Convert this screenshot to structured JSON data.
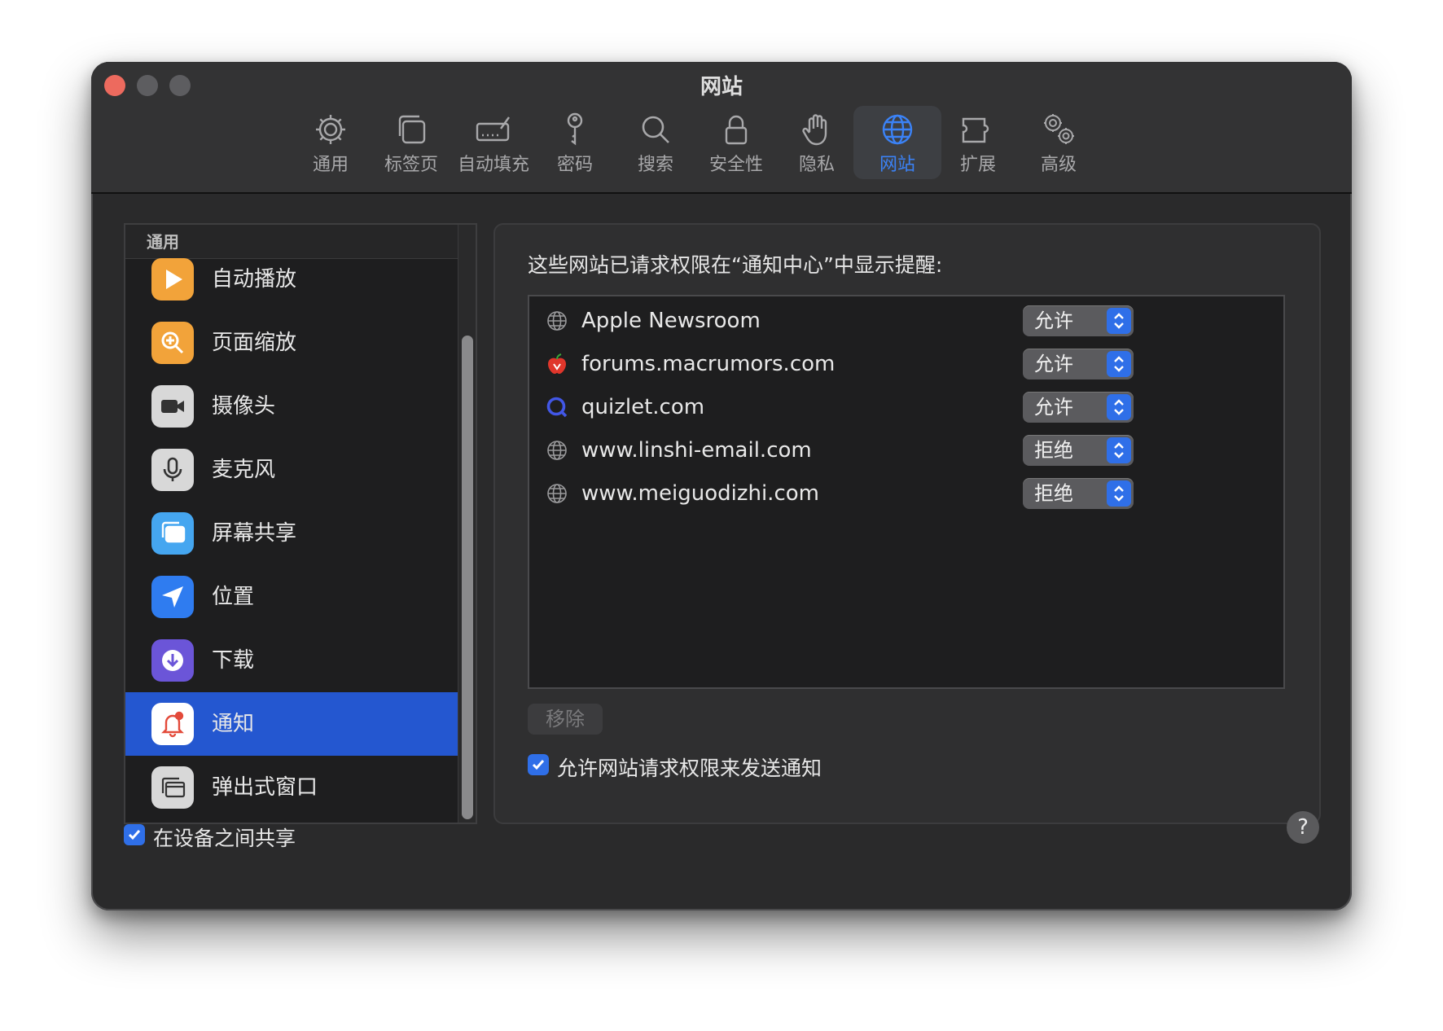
{
  "window": {
    "title": "网站"
  },
  "toolbar": {
    "tabs": [
      {
        "label": "通用",
        "icon": "gear-icon"
      },
      {
        "label": "标签页",
        "icon": "tabs-icon"
      },
      {
        "label": "自动填充",
        "icon": "autofill-icon"
      },
      {
        "label": "密码",
        "icon": "key-icon"
      },
      {
        "label": "搜索",
        "icon": "search-icon"
      },
      {
        "label": "安全性",
        "icon": "lock-icon"
      },
      {
        "label": "隐私",
        "icon": "hand-icon"
      },
      {
        "label": "网站",
        "icon": "globe-icon",
        "active": true
      },
      {
        "label": "扩展",
        "icon": "puzzle-icon"
      },
      {
        "label": "高级",
        "icon": "gears-icon"
      }
    ]
  },
  "sidebar": {
    "header": "通用",
    "items": [
      {
        "label": "自动播放",
        "icon": "play-icon",
        "color": "#f2a33a"
      },
      {
        "label": "页面缩放",
        "icon": "zoom-icon",
        "color": "#f2a33a"
      },
      {
        "label": "摄像头",
        "icon": "camera-icon",
        "color": "#d8d8d8"
      },
      {
        "label": "麦克风",
        "icon": "microphone-icon",
        "color": "#d8d8d8"
      },
      {
        "label": "屏幕共享",
        "icon": "screen-share-icon",
        "color": "#45a6f0"
      },
      {
        "label": "位置",
        "icon": "location-icon",
        "color": "#2f7cf0"
      },
      {
        "label": "下载",
        "icon": "download-icon",
        "color": "#6b55d8"
      },
      {
        "label": "通知",
        "icon": "bell-icon",
        "color": "#ffffff",
        "selected": true
      },
      {
        "label": "弹出式窗口",
        "icon": "popup-window-icon",
        "color": "#d8d8d8"
      }
    ]
  },
  "panel": {
    "description": "这些网站已请求权限在“通知中心”中显示提醒:",
    "sites": [
      {
        "name": "Apple Newsroom",
        "icon": "globe-icon",
        "permission": "允许"
      },
      {
        "name": "forums.macrumors.com",
        "icon": "macrumors-icon",
        "permission": "允许"
      },
      {
        "name": "quizlet.com",
        "icon": "quizlet-icon",
        "permission": "允许"
      },
      {
        "name": "www.linshi-email.com",
        "icon": "globe-icon",
        "permission": "拒绝"
      },
      {
        "name": "www.meiguodizhi.com",
        "icon": "globe-icon",
        "permission": "拒绝"
      }
    ],
    "remove_label": "移除",
    "allow_requests_label": "允许网站请求权限来发送通知",
    "allow_requests_checked": true
  },
  "footer": {
    "share_label": "在设备之间共享",
    "share_checked": true,
    "help_label": "?"
  },
  "colors": {
    "accent": "#2f6fe8",
    "selection": "#2457d0",
    "close": "#ed6a5e"
  }
}
